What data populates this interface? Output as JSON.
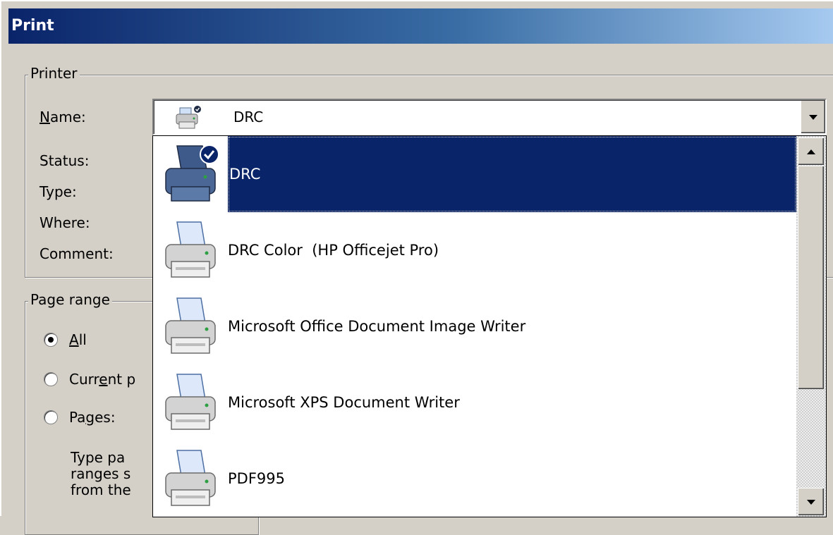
{
  "window": {
    "title": "Print"
  },
  "printer": {
    "group_label": "Printer",
    "name_label_mnemonic": "N",
    "name_label_rest": "ame:",
    "status_label": "Status:",
    "type_label": "Type:",
    "where_label": "Where:",
    "comment_label": "Comment:",
    "selected": "DRC",
    "options": [
      {
        "label": "DRC",
        "icon": "printer-default-icon",
        "selected": true
      },
      {
        "label": "DRC Color  (HP Officejet Pro)",
        "icon": "printer-icon",
        "selected": false
      },
      {
        "label": "Microsoft Office Document Image Writer",
        "icon": "printer-icon",
        "selected": false
      },
      {
        "label": "Microsoft XPS Document Writer",
        "icon": "printer-icon",
        "selected": false
      },
      {
        "label": "PDF995",
        "icon": "printer-icon",
        "selected": false
      }
    ]
  },
  "page_range": {
    "group_label": "Page range",
    "all_mnemonic": "A",
    "all_rest": "ll",
    "current_pre": "Curr",
    "current_mnemonic": "e",
    "current_rest": "nt p",
    "pages_pre": "Pa",
    "pages_mnemonic": "g",
    "pages_rest": "es:",
    "help_text": "Type pa\nranges s\nfrom the",
    "selected": "all"
  },
  "colors": {
    "title_start": "#0a246a",
    "title_end": "#a6caf0",
    "selection": "#0a246a",
    "dialog_bg": "#d4d0c8"
  }
}
